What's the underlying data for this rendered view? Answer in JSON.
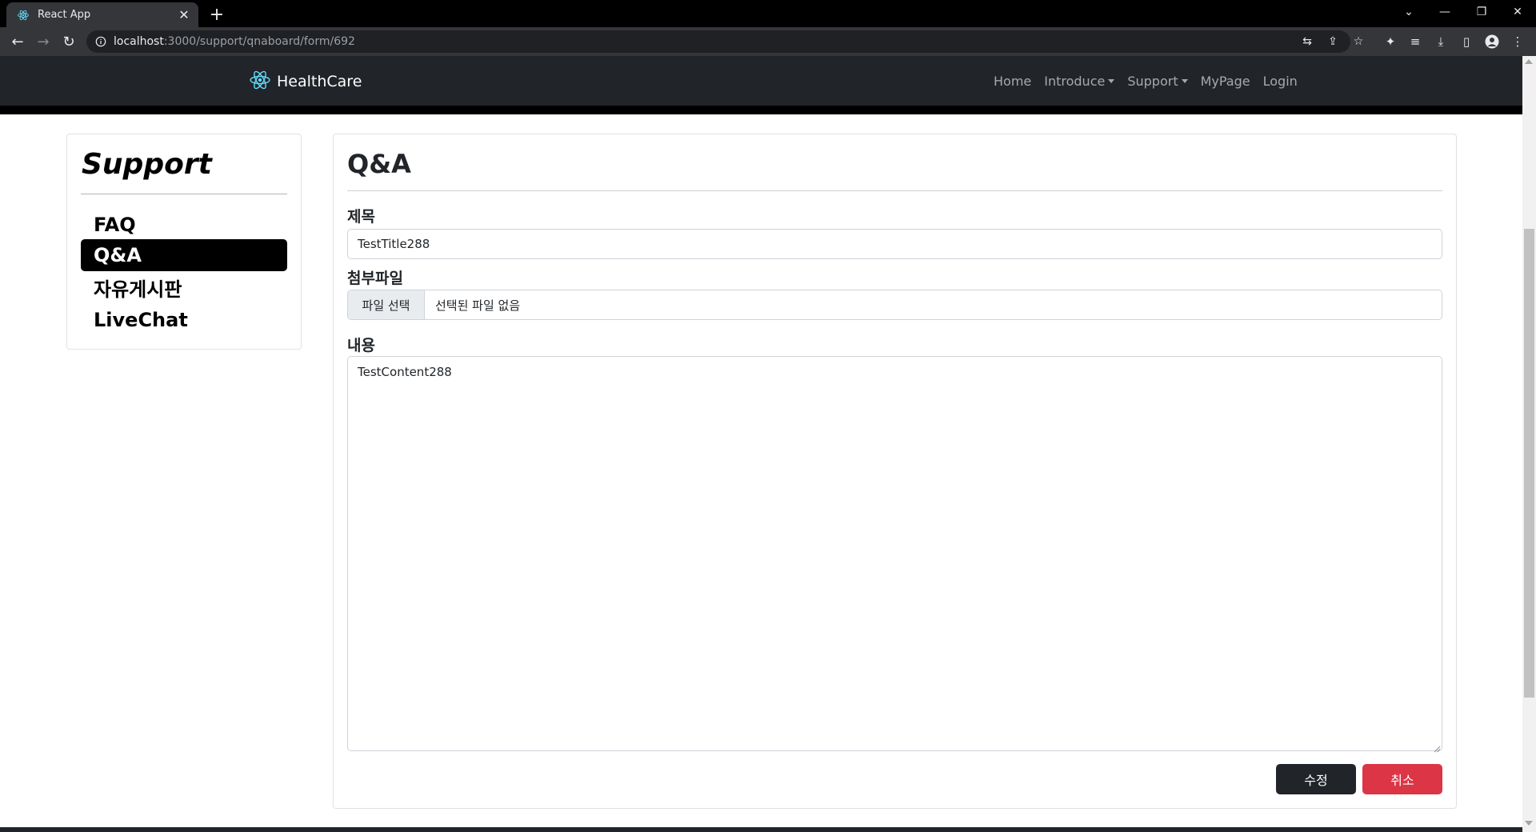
{
  "browser": {
    "tab_title": "React App",
    "url_host": "localhost",
    "url_path": ":3000/support/qnaboard/form/692"
  },
  "navbar": {
    "brand": "HealthCare",
    "links": [
      "Home",
      "Introduce",
      "Support",
      "MyPage",
      "Login"
    ],
    "accent": "#61dafb"
  },
  "sidebar": {
    "title": "Support",
    "items": [
      {
        "label": "FAQ",
        "active": false
      },
      {
        "label": "Q&A",
        "active": true
      },
      {
        "label": "자유게시판",
        "active": false
      },
      {
        "label": "LiveChat",
        "active": false
      }
    ]
  },
  "form": {
    "page_title": "Q&A",
    "title_label": "제목",
    "title_value": "TestTitle288",
    "file_label": "첨부파일",
    "file_button": "파일 선택",
    "file_status": "선택된 파일 없음",
    "content_label": "내용",
    "content_value": "TestContent288",
    "submit_label": "수정",
    "cancel_label": "취소"
  },
  "colors": {
    "dark": "#212529",
    "danger": "#dc3545"
  }
}
